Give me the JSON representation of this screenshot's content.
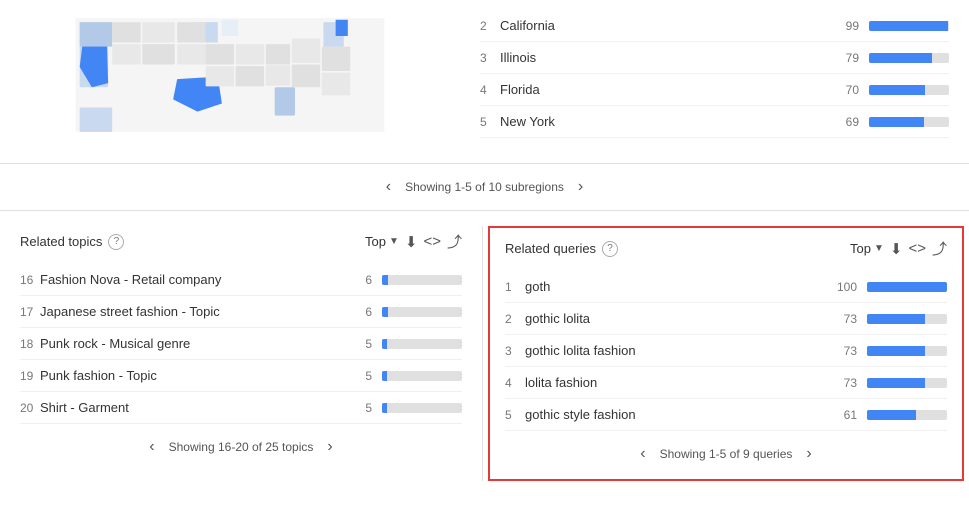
{
  "top_section": {
    "regions": [
      {
        "num": 3,
        "name": "Illinois",
        "value": 79,
        "pct": 79
      },
      {
        "num": 4,
        "name": "Florida",
        "value": 70,
        "pct": 70
      },
      {
        "num": 5,
        "name": "New York",
        "value": 69,
        "pct": 69
      }
    ],
    "pagination_text": "Showing 1-5 of 10 subregions"
  },
  "related_topics": {
    "title": "Related topics",
    "dropdown_label": "Top",
    "items": [
      {
        "num": 16,
        "name": "Fashion Nova - Retail company",
        "value": 6,
        "pct": 8
      },
      {
        "num": 17,
        "name": "Japanese street fashion - Topic",
        "value": 6,
        "pct": 8
      },
      {
        "num": 18,
        "name": "Punk rock - Musical genre",
        "value": 5,
        "pct": 6
      },
      {
        "num": 19,
        "name": "Punk fashion - Topic",
        "value": 5,
        "pct": 6
      },
      {
        "num": 20,
        "name": "Shirt - Garment",
        "value": 5,
        "pct": 6
      }
    ],
    "pagination_text": "Showing 16-20 of 25 topics"
  },
  "related_queries": {
    "title": "Related queries",
    "dropdown_label": "Top",
    "items": [
      {
        "num": 1,
        "name": "goth",
        "value": 100,
        "pct": 100
      },
      {
        "num": 2,
        "name": "gothic lolita",
        "value": 73,
        "pct": 73
      },
      {
        "num": 3,
        "name": "gothic lolita fashion",
        "value": 73,
        "pct": 73
      },
      {
        "num": 4,
        "name": "lolita fashion",
        "value": 73,
        "pct": 73
      },
      {
        "num": 5,
        "name": "gothic style fashion",
        "value": 61,
        "pct": 61
      }
    ],
    "pagination_text": "Showing 1-5 of 9 queries"
  },
  "icons": {
    "chevron_left": "‹",
    "chevron_right": "›",
    "download": "⬇",
    "embed": "<>",
    "share": "⤴",
    "help": "?"
  }
}
